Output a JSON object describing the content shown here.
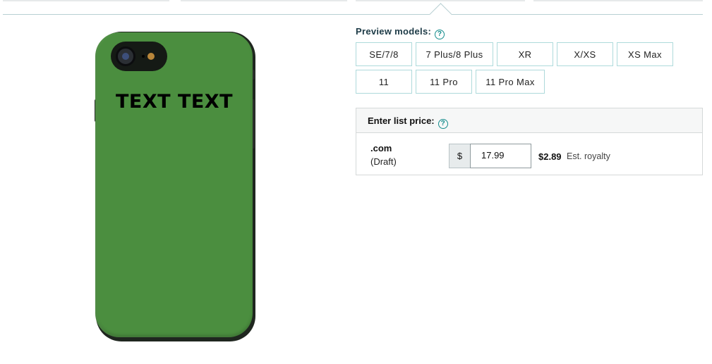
{
  "preview": {
    "label": "Preview models:",
    "help_icon": "?"
  },
  "models": [
    {
      "label": "SE/7/8"
    },
    {
      "label": "7 Plus/8 Plus"
    },
    {
      "label": "XR"
    },
    {
      "label": "X/XS"
    },
    {
      "label": "XS Max"
    },
    {
      "label": "11"
    },
    {
      "label": "11 Pro"
    },
    {
      "label": "11 Pro Max"
    }
  ],
  "product": {
    "design_text": "TEXT TEXT",
    "case_color": "#4b8e3f"
  },
  "pricing": {
    "header": "Enter list price:",
    "help_icon": "?",
    "marketplace": ".com",
    "status": "(Draft)",
    "currency": "$",
    "price": "17.99",
    "royalty": "$2.89",
    "royalty_label": "Est. royalty"
  },
  "colors": {
    "accent": "#148c8c",
    "button_border": "#aedadb"
  }
}
